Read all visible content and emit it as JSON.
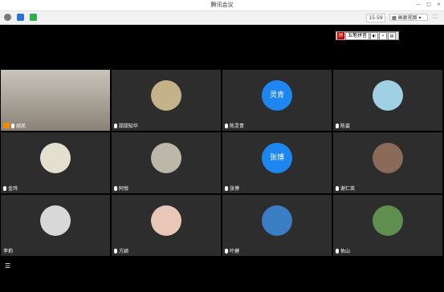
{
  "window": {
    "title": "腾讯会议",
    "controls": [
      "—",
      "□",
      "×"
    ]
  },
  "toolbar": {
    "timer": "15:59",
    "view_label": "画廊视图",
    "view_arrow": "▾",
    "fullscreen": "⛶"
  },
  "ime": {
    "label": "五笔拼音",
    "logo": "拼"
  },
  "participants": [
    {
      "name": "胡凤",
      "avatar": "video",
      "host": true
    },
    {
      "name": "甜甜知华",
      "avatar": "photo-woman-flowers"
    },
    {
      "name": "陈灵青",
      "avatar_text": "灵青",
      "avatar": "blue"
    },
    {
      "name": "陈姿",
      "avatar": "photo-beach"
    },
    {
      "name": "金玮",
      "avatar": "photo-cartoon"
    },
    {
      "name": "阿悦",
      "avatar": "photo-sketch"
    },
    {
      "name": "张博",
      "avatar_text": "张博",
      "avatar": "blue"
    },
    {
      "name": "谢仁英",
      "avatar": "photo-room"
    },
    {
      "name": "李莉",
      "avatar": "photo-woman"
    },
    {
      "name": "方颖",
      "avatar": "photo-pinkhair"
    },
    {
      "name": "叶健",
      "avatar": "photo-seaside"
    },
    {
      "name": "佑山",
      "avatar": "photo-hills"
    }
  ]
}
